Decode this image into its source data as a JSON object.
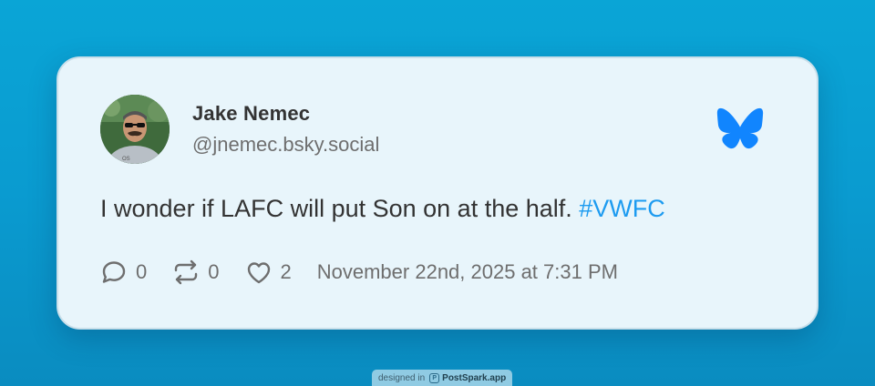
{
  "post": {
    "author_name": "Jake Nemec",
    "handle": "@jnemec.bsky.social",
    "text": "I wonder if LAFC will put Son on at the half. ",
    "hashtag": "#VWFC",
    "reply_count": "0",
    "repost_count": "0",
    "like_count": "2",
    "timestamp": "November 22nd, 2025 at 7:31 PM"
  },
  "icons": {
    "platform": "bluesky-butterfly-icon",
    "reply": "speech-bubble-icon",
    "repost": "repost-arrows-icon",
    "like": "heart-icon"
  },
  "colors": {
    "background": "#0aa5d6",
    "card": "#e8f5fb",
    "hashtag": "#1d9bf0",
    "bluesky": "#1185fe",
    "text": "#333333",
    "muted": "#6e6e6e"
  },
  "watermark": {
    "prefix": "designed in",
    "brand": "PostSpark.app"
  }
}
